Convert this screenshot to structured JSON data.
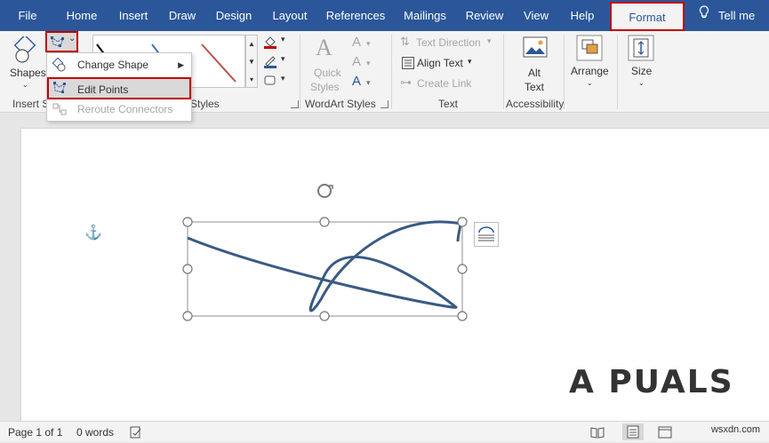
{
  "tabs": {
    "file": "File",
    "home": "Home",
    "insert": "Insert",
    "draw": "Draw",
    "design": "Design",
    "layout": "Layout",
    "references": "References",
    "mailings": "Mailings",
    "review": "Review",
    "view": "View",
    "help": "Help",
    "format": "Format",
    "tellme": "Tell me"
  },
  "ribbon": {
    "shapes_label": "Shapes",
    "insert_shapes_group": "Insert S",
    "styles_group_fragment": "Styles",
    "quick_styles": "Quick Styles",
    "quick": "Quick",
    "styles": "Styles",
    "wordart_group": "WordArt Styles",
    "text_direction": "Text Direction",
    "align_text": "Align Text",
    "create_link": "Create Link",
    "text_group": "Text",
    "alt_text_1": "Alt",
    "alt_text_2": "Text",
    "accessibility_group": "Accessibility",
    "arrange": "Arrange",
    "size": "Size"
  },
  "menu": {
    "change_shape": "Change Shape",
    "edit_points": "Edit Points",
    "reroute_connectors": "Reroute Connectors"
  },
  "status": {
    "page": "Page 1 of 1",
    "words": "0 words"
  },
  "watermark": "A PUALS",
  "site": "wsxdn.com",
  "colors": {
    "accent": "#2b579a",
    "highlight": "#c00000",
    "shape_line": "#3a5a85"
  }
}
